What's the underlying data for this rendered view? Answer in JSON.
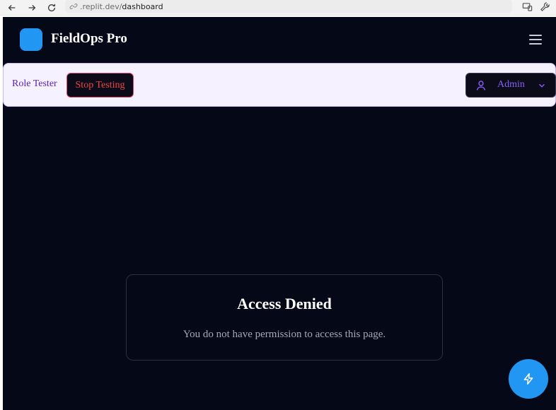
{
  "browser": {
    "url_host": ".replit.dev/",
    "url_path": "dashboard"
  },
  "header": {
    "app_title": "FieldOps Pro",
    "logo_color": "#2196f3"
  },
  "role_tester": {
    "label": "Role Tester",
    "stop_label": "Stop Testing",
    "selected_role": "Admin"
  },
  "access_denied": {
    "title": "Access Denied",
    "message": "You do not have permission to access this page."
  },
  "fab": {
    "icon": "lightning-icon",
    "color": "#2196f3"
  },
  "colors": {
    "background": "#050816",
    "accent_purple": "#8b5cf6",
    "danger": "#ef4444"
  }
}
